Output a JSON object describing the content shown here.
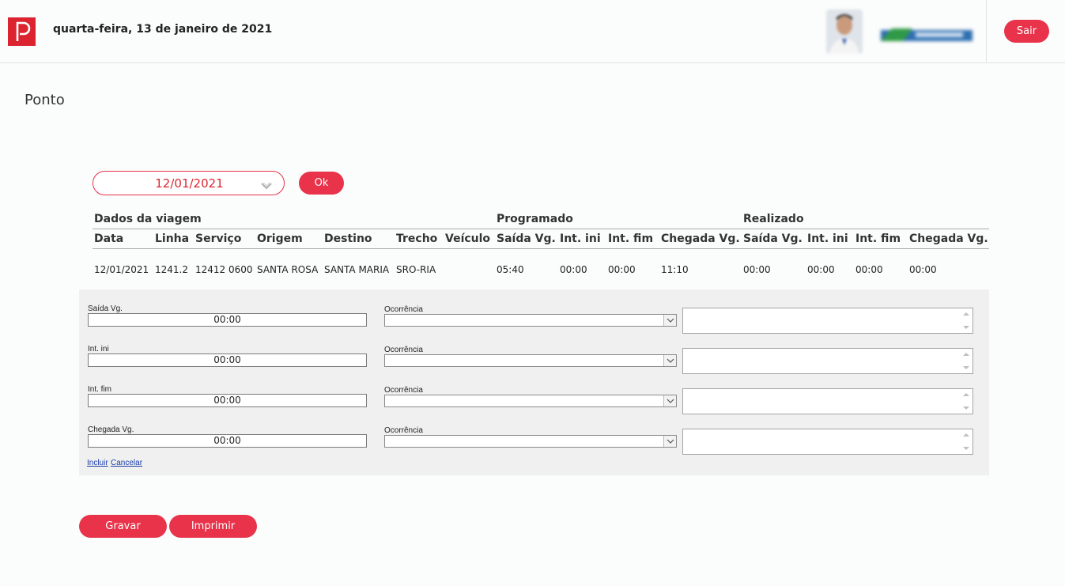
{
  "header": {
    "logo_icon": "red-p-logo-icon",
    "date_text": "quarta-feira, 13 de janeiro de 2021",
    "avatar_icon": "user-avatar",
    "company_logo_icon": "company-logo",
    "logout_label": "Sair"
  },
  "page": {
    "title": "Ponto"
  },
  "filter": {
    "date_value": "12/01/2021",
    "ok_label": "Ok"
  },
  "table": {
    "groups": {
      "trip": "Dados da viagem",
      "scheduled": "Programado",
      "actual": "Realizado"
    },
    "columns": {
      "data": "Data",
      "linha": "Linha",
      "servico": "Serviço",
      "origem": "Origem",
      "destino": "Destino",
      "trecho": "Trecho",
      "veiculo": "Veículo",
      "p_saida": "Saída Vg.",
      "p_int_ini": "Int. ini",
      "p_int_fim": "Int. fim",
      "p_chegada": "Chegada Vg.",
      "r_saida": "Saída Vg.",
      "r_int_ini": "Int. ini",
      "r_int_fim": "Int. fim",
      "r_chegada": "Chegada Vg."
    },
    "row": {
      "data": "12/01/2021",
      "linha": "1241.2",
      "servico": "12412 0600",
      "origem": "SANTA ROSA",
      "destino": "SANTA MARIA",
      "trecho": "SRO-RIA",
      "veiculo": "",
      "p_saida": "05:40",
      "p_int_ini": "00:00",
      "p_int_fim": "00:00",
      "p_chegada": "11:10",
      "r_saida": "00:00",
      "r_int_ini": "00:00",
      "r_int_fim": "00:00",
      "r_chegada": "00:00"
    }
  },
  "edit_panel": {
    "fields": [
      {
        "label": "Saída Vg.",
        "value": "00:00",
        "occurrence_label": "Ocorrência",
        "occurrence_value": "",
        "note": ""
      },
      {
        "label": "Int. ini",
        "value": "00:00",
        "occurrence_label": "Ocorrência",
        "occurrence_value": "",
        "note": ""
      },
      {
        "label": "Int. fim",
        "value": "00:00",
        "occurrence_label": "Ocorrência",
        "occurrence_value": "",
        "note": ""
      },
      {
        "label": "Chegada Vg.",
        "value": "00:00",
        "occurrence_label": "Ocorrência",
        "occurrence_value": "",
        "note": ""
      }
    ],
    "include_link": "Incluir",
    "cancel_link": "Cancelar"
  },
  "actions": {
    "save_label": "Gravar",
    "print_label": "Imprimir"
  },
  "colors": {
    "accent": "#e8334a",
    "logo_red": "#dc2430",
    "panel_bg": "#f0f0f0",
    "link": "#1a3ea8"
  }
}
